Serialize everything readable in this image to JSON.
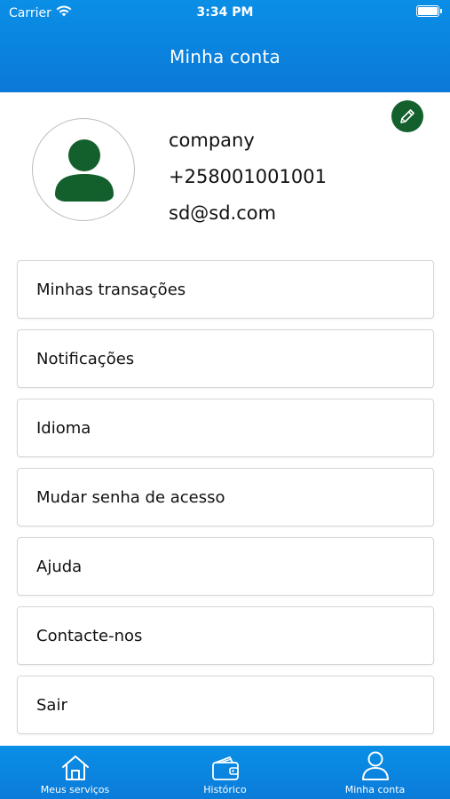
{
  "status_bar": {
    "carrier": "Carrier",
    "time": "3:34 PM"
  },
  "header": {
    "title": "Minha conta"
  },
  "profile": {
    "name": "company",
    "phone": "+258001001001",
    "email": "sd@sd.com",
    "avatar_color": "#13602d"
  },
  "menu": {
    "items": [
      {
        "label": "Minhas transações"
      },
      {
        "label": "Notificações"
      },
      {
        "label": "Idioma"
      },
      {
        "label": "Mudar senha de acesso"
      },
      {
        "label": "Ajuda"
      },
      {
        "label": "Contacte-nos"
      },
      {
        "label": "Sair"
      }
    ]
  },
  "tabbar": {
    "tabs": [
      {
        "label": "Meus serviços",
        "icon": "home-icon"
      },
      {
        "label": "Histórico",
        "icon": "wallet-icon"
      },
      {
        "label": "Minha conta",
        "icon": "user-icon"
      }
    ]
  },
  "colors": {
    "primary_blue": "#0a8fe6",
    "accent_green": "#13602d"
  }
}
